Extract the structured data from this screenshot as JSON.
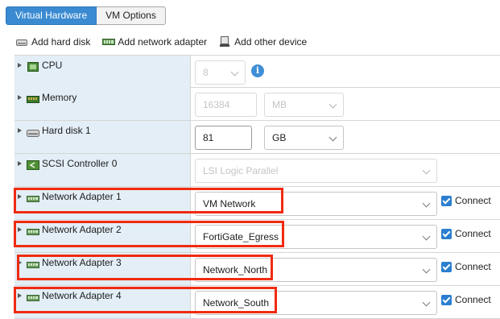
{
  "tabs": [
    {
      "label": "Virtual Hardware",
      "active": true
    },
    {
      "label": "VM Options",
      "active": false
    }
  ],
  "toolbar": {
    "add_hard_disk": "Add hard disk",
    "add_network_adapter": "Add network adapter",
    "add_other_device": "Add other device"
  },
  "devices": {
    "cpu": {
      "label": "CPU",
      "value": "8",
      "icon": "cpu-icon"
    },
    "memory": {
      "label": "Memory",
      "value": "16384",
      "unit": "MB",
      "icon": "memory-icon"
    },
    "hard_disk": {
      "label": "Hard disk 1",
      "value": "81",
      "unit": "GB",
      "icon": "hard-disk-icon"
    },
    "scsi": {
      "label": "SCSI Controller 0",
      "value": "LSI Logic Parallel",
      "icon": "scsi-controller-icon"
    },
    "net1": {
      "label": "Network Adapter 1",
      "network": "VM Network",
      "connect": "Connect",
      "connected": true
    },
    "net2": {
      "label": "Network Adapter 2",
      "network": "FortiGate_Egress",
      "connect": "Connect",
      "connected": true
    },
    "net3": {
      "label": "Network Adapter 3",
      "network": "Network_North",
      "connect": "Connect",
      "connected": true
    },
    "net4": {
      "label": "Network Adapter 4",
      "network": "Network_South",
      "connect": "Connect",
      "connected": true
    }
  },
  "colors": {
    "accent": "#3a8ad1",
    "highlight": "#f02b10",
    "label_bg": "#e3eef6"
  }
}
